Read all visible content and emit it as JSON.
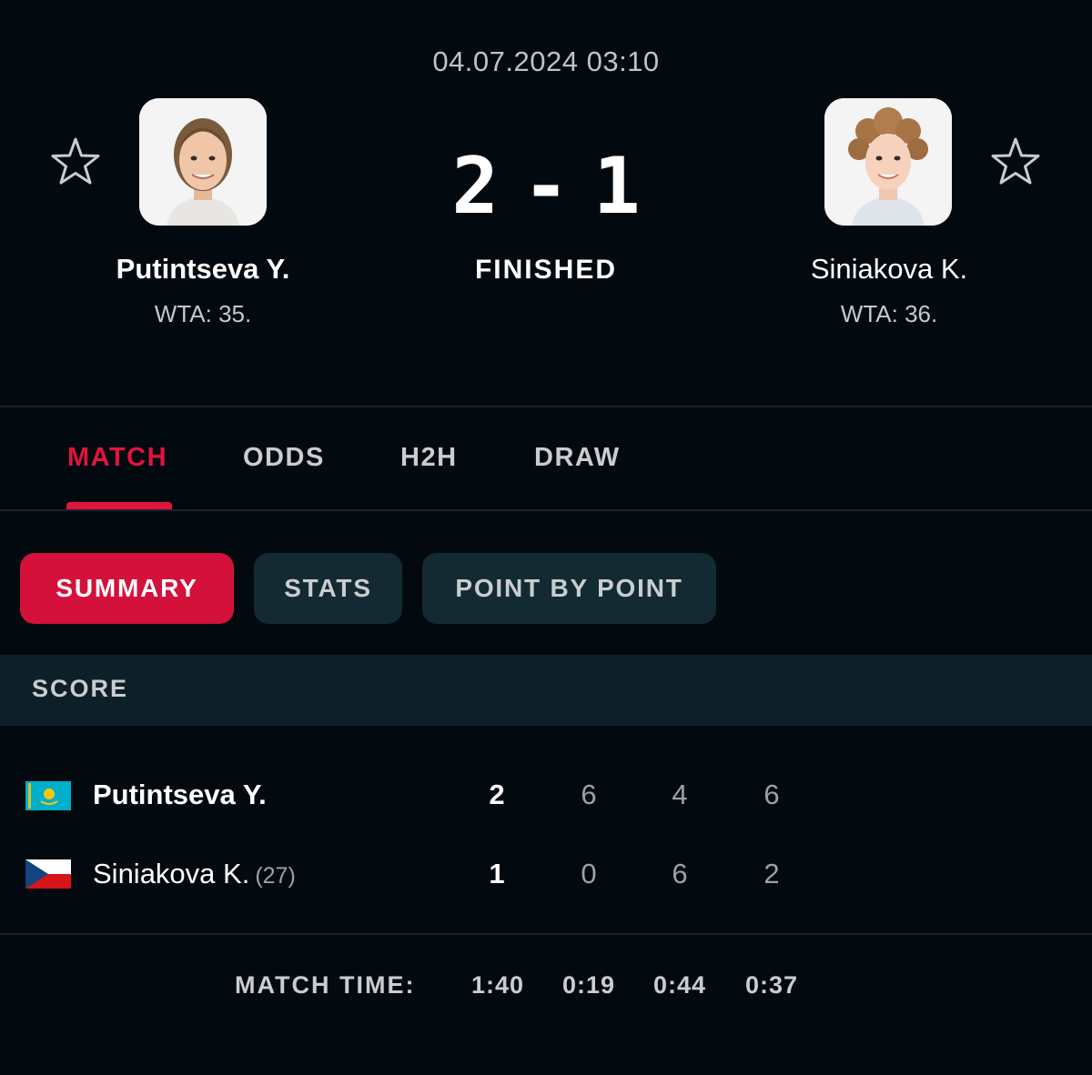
{
  "header": {
    "datetime": "04.07.2024 03:10",
    "score_home": "2",
    "score_separator": "-",
    "score_away": "1",
    "status": "FINISHED"
  },
  "home": {
    "name": "Putintseva Y.",
    "rank": "WTA: 35.",
    "avatar_icon": "player-photo",
    "favorite_icon": "star-outline-icon"
  },
  "away": {
    "name": "Siniakova K.",
    "rank": "WTA: 36.",
    "avatar_icon": "player-photo",
    "favorite_icon": "star-outline-icon"
  },
  "tabs": [
    {
      "label": "MATCH",
      "active": true
    },
    {
      "label": "ODDS",
      "active": false
    },
    {
      "label": "H2H",
      "active": false
    },
    {
      "label": "DRAW",
      "active": false
    }
  ],
  "subtabs": [
    {
      "label": "SUMMARY",
      "active": true
    },
    {
      "label": "STATS",
      "active": false
    },
    {
      "label": "POINT BY POINT",
      "active": false
    }
  ],
  "score_section": {
    "title": "SCORE",
    "rows": [
      {
        "flag": "kazakhstan-flag",
        "name": "Putintseva Y.",
        "seed": "",
        "total": "2",
        "sets": [
          "6",
          "4",
          "6"
        ]
      },
      {
        "flag": "czech-flag",
        "name": "Siniakova K.",
        "seed": "(27)",
        "total": "1",
        "sets": [
          "0",
          "6",
          "2"
        ]
      }
    ],
    "match_time_label": "MATCH TIME:",
    "match_times": [
      "1:40",
      "0:19",
      "0:44",
      "0:37"
    ]
  },
  "colors": {
    "background": "#030a0f",
    "accent": "#e1133f",
    "panel": "#132a33"
  }
}
